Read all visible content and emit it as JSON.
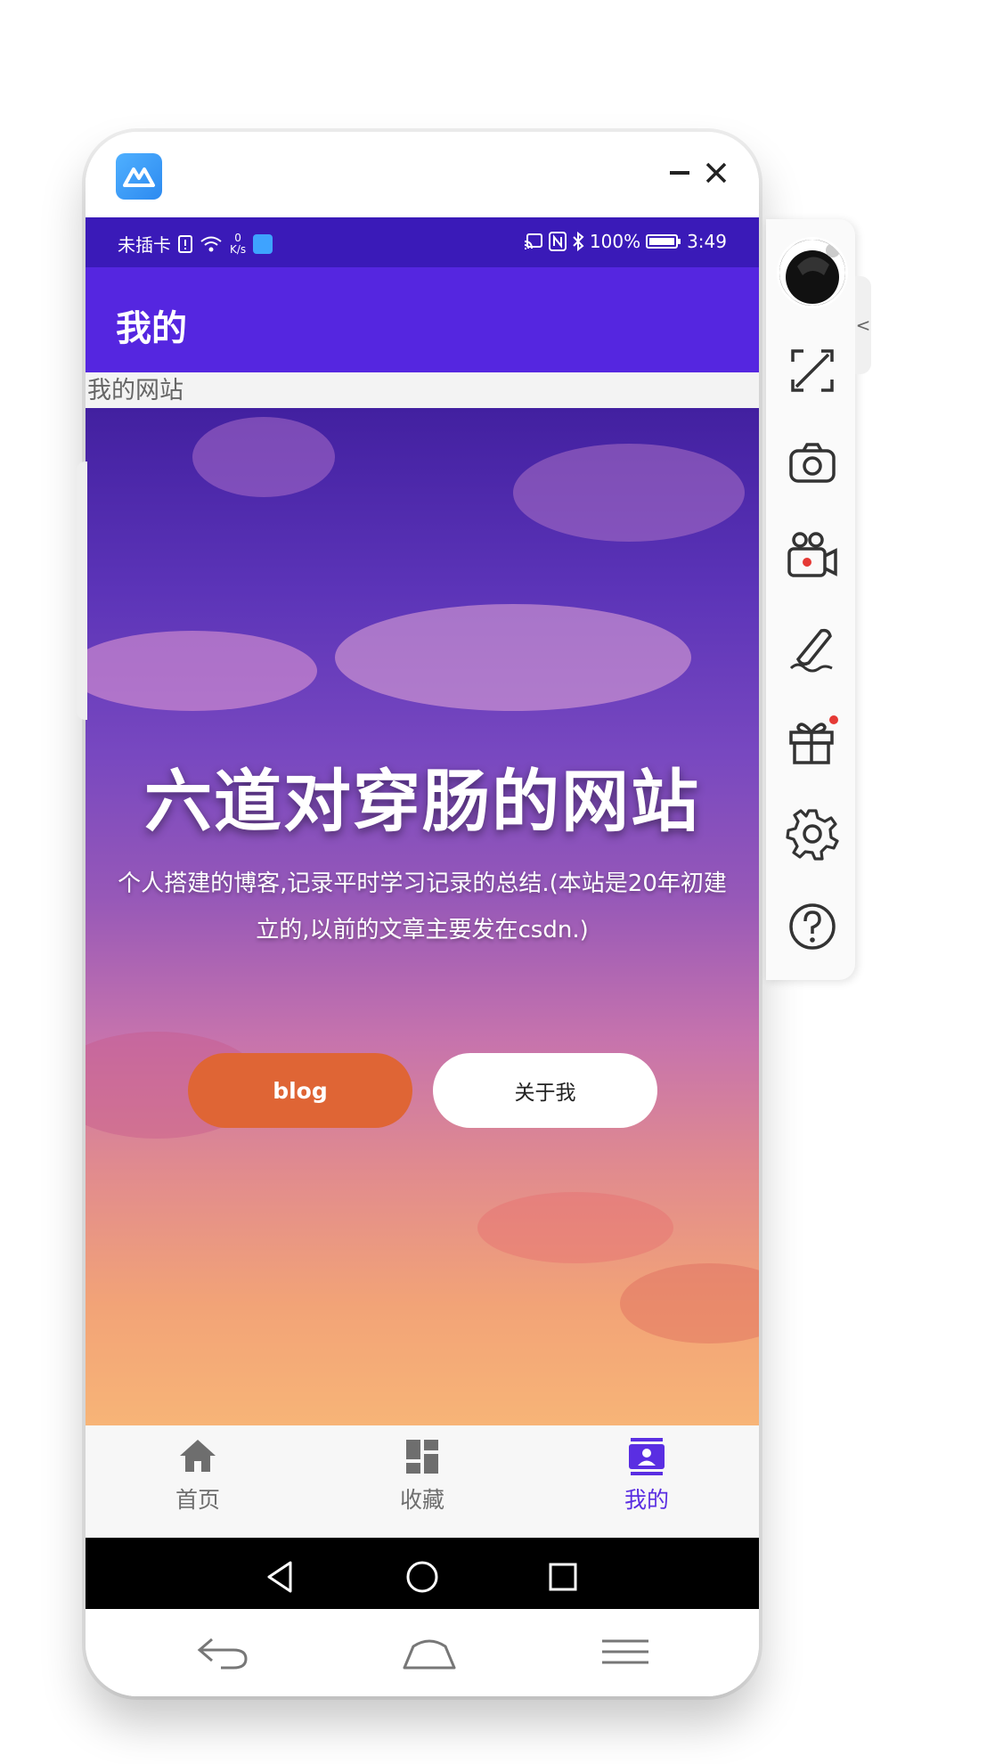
{
  "window": {
    "app_logo_icon": "mirroring-app-logo",
    "minimize_icon": "minimize-icon",
    "close_icon": "close-icon"
  },
  "status_bar": {
    "carrier": "未插卡",
    "net_speed_value": "0",
    "net_speed_unit": "K/s",
    "battery": "100%",
    "time": "3:49"
  },
  "app_bar": {
    "title": "我的"
  },
  "web": {
    "heading": "我的网站",
    "hero_title": "六道对穿肠的网站",
    "hero_desc": "个人搭建的博客,记录平时学习记录的总结.(本站是20年初建立的,以前的文章主要发在csdn.)",
    "buttons": {
      "blog": "blog",
      "about": "关于我"
    }
  },
  "bottom_nav": {
    "items": [
      {
        "label": "首页",
        "icon": "home-icon"
      },
      {
        "label": "收藏",
        "icon": "dashboard-icon"
      },
      {
        "label": "我的",
        "icon": "contact-icon"
      }
    ],
    "active_index": 2
  },
  "colors": {
    "status_bar": "#3a1ab8",
    "app_bar": "#5526e0",
    "accent": "#5a2ee2",
    "blog_button": "#df6535"
  },
  "side_toolbar": {
    "collapse_glyph": "<",
    "tools": [
      "fullscreen-icon",
      "screenshot-icon",
      "record-icon",
      "draw-icon",
      "gift-icon",
      "settings-icon",
      "help-icon"
    ]
  }
}
